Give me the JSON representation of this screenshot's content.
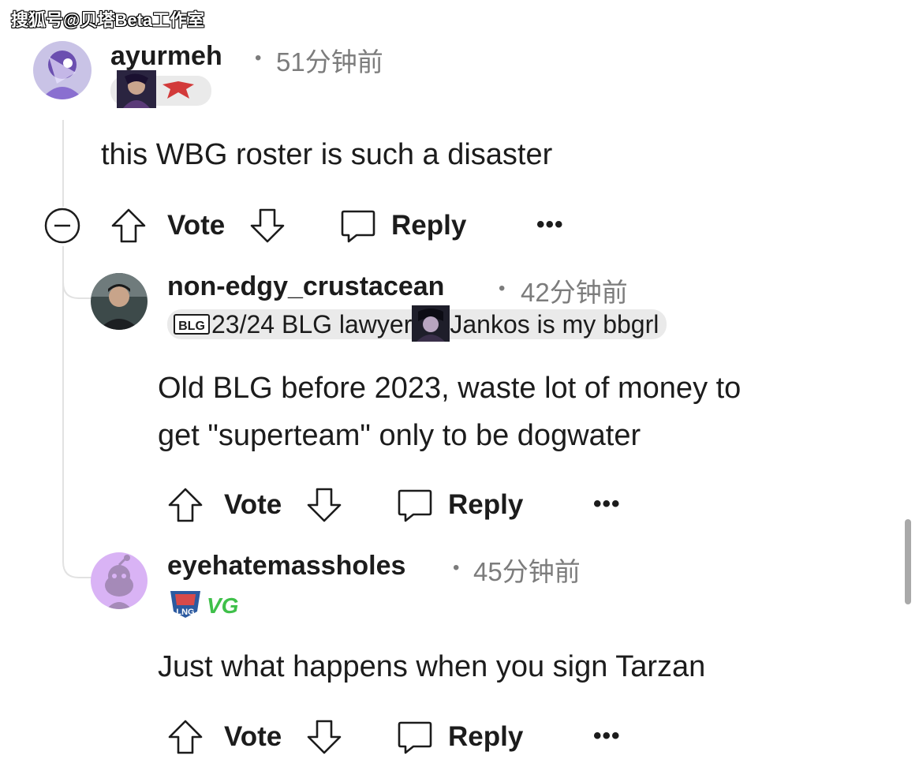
{
  "watermark": "搜狐号@贝塔Beta工作室",
  "comments": [
    {
      "username": "ayurmeh",
      "time": "51分钟前",
      "body": "this WBG roster is such a disaster",
      "actions": {
        "vote": "Vote",
        "reply": "Reply",
        "more": "•••"
      }
    },
    {
      "username": "non-edgy_crustacean",
      "time": "42分钟前",
      "flair": {
        "part1": "23/24 BLG lawyer",
        "part2": "Jankos is my bbgrl",
        "badge": "BLG"
      },
      "body_lines": [
        "Old BLG before 2023, waste lot of money to",
        "get \"superteam\" only to be dogwater"
      ],
      "actions": {
        "vote": "Vote",
        "reply": "Reply",
        "more": "•••"
      }
    },
    {
      "username": "eyehatemassholes",
      "time": "45分钟前",
      "flair": {
        "badge1": "LNG",
        "badge2": "VG"
      },
      "body": "Just what happens when you sign Tarzan",
      "actions": {
        "vote": "Vote",
        "reply": "Reply",
        "more": "•••"
      }
    }
  ],
  "separator": "•",
  "colors": {
    "text": "#1c1c1c",
    "meta": "#7c7c7c",
    "flair_bg": "#eaeaea",
    "thread_line": "#e2e2e2",
    "snoo_bg": "#d9b3f5"
  }
}
